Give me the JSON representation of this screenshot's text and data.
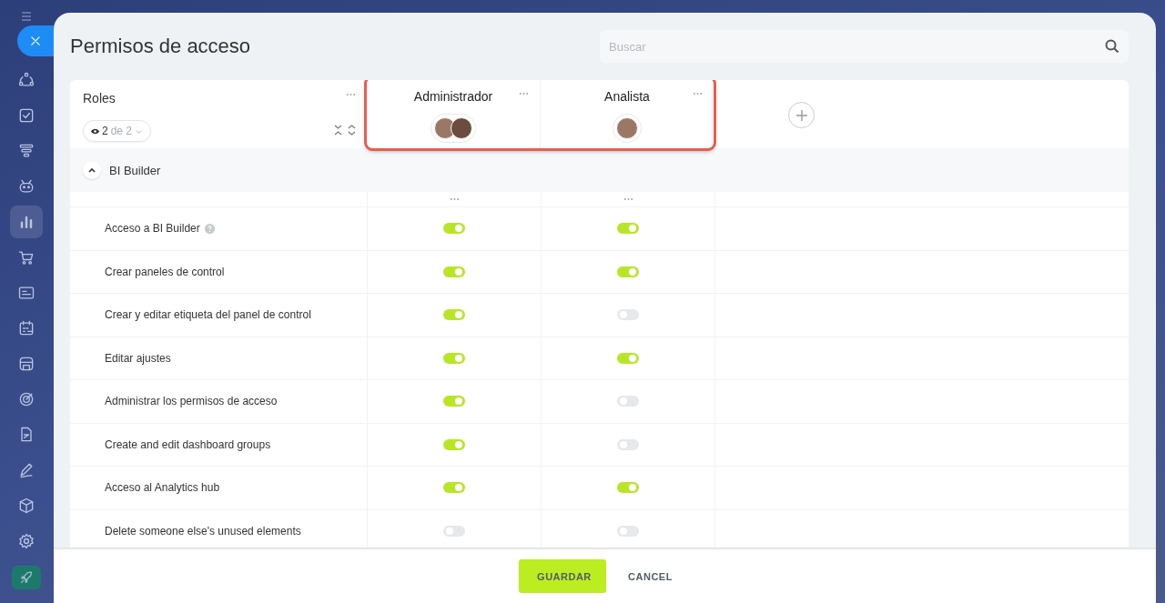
{
  "sidebar": {
    "items": [
      {
        "kind": "nodes",
        "selected": false
      },
      {
        "kind": "check",
        "selected": false
      },
      {
        "kind": "funnel",
        "selected": false
      },
      {
        "kind": "robot",
        "selected": false
      },
      {
        "kind": "chart",
        "selected": true
      },
      {
        "kind": "cart",
        "selected": false
      },
      {
        "kind": "card",
        "selected": false
      },
      {
        "kind": "calendar",
        "selected": false
      },
      {
        "kind": "store",
        "selected": false
      },
      {
        "kind": "target",
        "selected": false
      },
      {
        "kind": "doc",
        "selected": false
      },
      {
        "kind": "pen",
        "selected": false
      },
      {
        "kind": "box",
        "selected": false
      },
      {
        "kind": "gear",
        "selected": false
      }
    ]
  },
  "title": "Permisos de acceso",
  "search": {
    "placeholder": "Buscar"
  },
  "roles_header": {
    "label": "Roles",
    "count": "2",
    "count_total": "de 2"
  },
  "roles": [
    {
      "name": "Administrador",
      "members": [
        {
          "kind": "photo"
        },
        {
          "kind": "photo"
        }
      ]
    },
    {
      "name": "Analista",
      "members": [
        {
          "kind": "photo"
        }
      ]
    }
  ],
  "roles_highlighted": true,
  "section": {
    "title": "BI Builder",
    "expanded": true
  },
  "permissions": [
    {
      "label": "Acceso a BI Builder",
      "help": true,
      "values": [
        {
          "on": true
        },
        {
          "on": true
        }
      ]
    },
    {
      "label": "Crear paneles de control",
      "help": false,
      "values": [
        {
          "on": true
        },
        {
          "on": true
        }
      ]
    },
    {
      "label": "Crear y editar etiqueta del panel de control",
      "help": false,
      "values": [
        {
          "on": true
        },
        {
          "on": false
        }
      ]
    },
    {
      "label": "Editar ajustes",
      "help": false,
      "values": [
        {
          "on": true
        },
        {
          "on": true
        }
      ]
    },
    {
      "label": "Administrar los permisos de acceso",
      "help": false,
      "values": [
        {
          "on": true
        },
        {
          "on": false
        }
      ]
    },
    {
      "label": "Create and edit dashboard groups",
      "help": false,
      "values": [
        {
          "on": true
        },
        {
          "on": false
        }
      ]
    },
    {
      "label": "Acceso al Analytics hub",
      "help": false,
      "values": [
        {
          "on": true
        },
        {
          "on": true
        }
      ]
    },
    {
      "label": "Delete someone else's unused elements",
      "help": false,
      "values": [
        {
          "on": false
        },
        {
          "on": false
        }
      ]
    }
  ],
  "buttons": [
    {
      "label": "GUARDAR",
      "kind": "primary"
    },
    {
      "label": "CANCEL",
      "kind": "link"
    }
  ]
}
